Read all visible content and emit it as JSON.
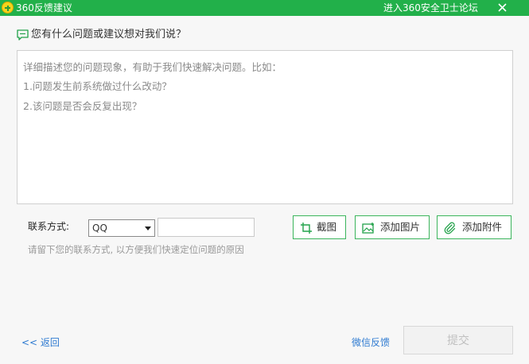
{
  "window": {
    "title": "360反馈建议",
    "forum_link": "进入360安全卫士论坛",
    "accent": "#22b04a"
  },
  "question": {
    "title": "您有什么问题或建议想对我们说？"
  },
  "description": {
    "placeholder_lines": [
      "详细描述您的问题现象，有助于我们快速解决问题。比如：",
      "1.问题发生前系统做过什么改动？",
      "2.该问题是否会反复出现？"
    ]
  },
  "contact": {
    "label": "联系方式:",
    "selected": "QQ",
    "value": "",
    "hint": "请留下您的联系方式, 以方便我们快速定位问题的原因"
  },
  "actions": {
    "screenshot": "截图",
    "add_image": "添加图片",
    "add_attachment": "添加附件"
  },
  "footer": {
    "back": "<< 返回",
    "wechat_feedback": "微信反馈",
    "submit": "提交"
  },
  "icons": [
    "logo-icon",
    "close-icon",
    "feedback-icon",
    "crop-icon",
    "image-icon",
    "paperclip-icon"
  ]
}
